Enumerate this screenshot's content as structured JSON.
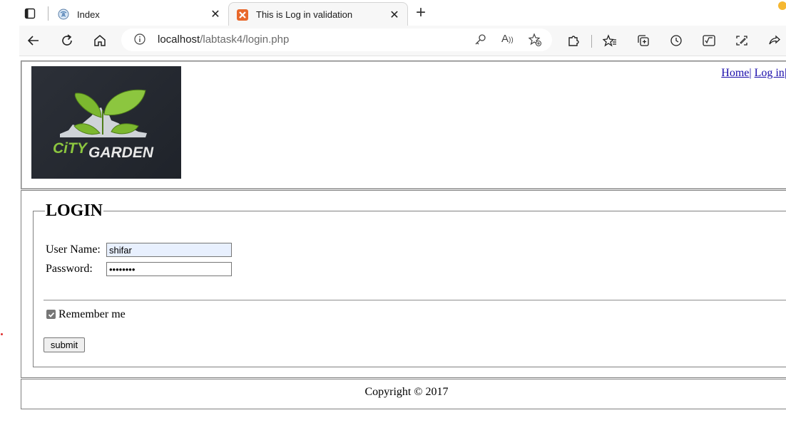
{
  "browser": {
    "tabs": [
      {
        "title": "Index",
        "active": false
      },
      {
        "title": "This is Log in validation",
        "active": true
      }
    ],
    "address": {
      "host": "localhost",
      "path": "/labtask4/login.php"
    },
    "icons": [
      "tab-actions-icon",
      "back-icon",
      "refresh-icon",
      "home-icon",
      "site-info-icon",
      "key-icon",
      "read-aloud-icon",
      "add-favorite-icon",
      "extensions-icon",
      "favorites-icon",
      "collections-icon",
      "history-icon",
      "math-solver-icon",
      "web-capture-icon",
      "share-icon"
    ]
  },
  "header": {
    "logo_text_1": "CiTY",
    "logo_text_2": "GARDEN",
    "nav": [
      {
        "label": "Home"
      },
      {
        "label": "Log in"
      }
    ]
  },
  "login": {
    "legend": "LOGIN",
    "username_label": "User Name:",
    "username_value": "shifar",
    "password_label": "Password:",
    "password_value": "shifar12",
    "remember_label": "Remember me",
    "remember_checked": true,
    "submit_label": "submit"
  },
  "footer": {
    "copyright": "Copyright © 2017"
  },
  "colors": {
    "link": "#1a0dab",
    "autofill": "#e8f0fe",
    "logo_bg": "#22262d",
    "logo_green": "#7cb82f"
  }
}
